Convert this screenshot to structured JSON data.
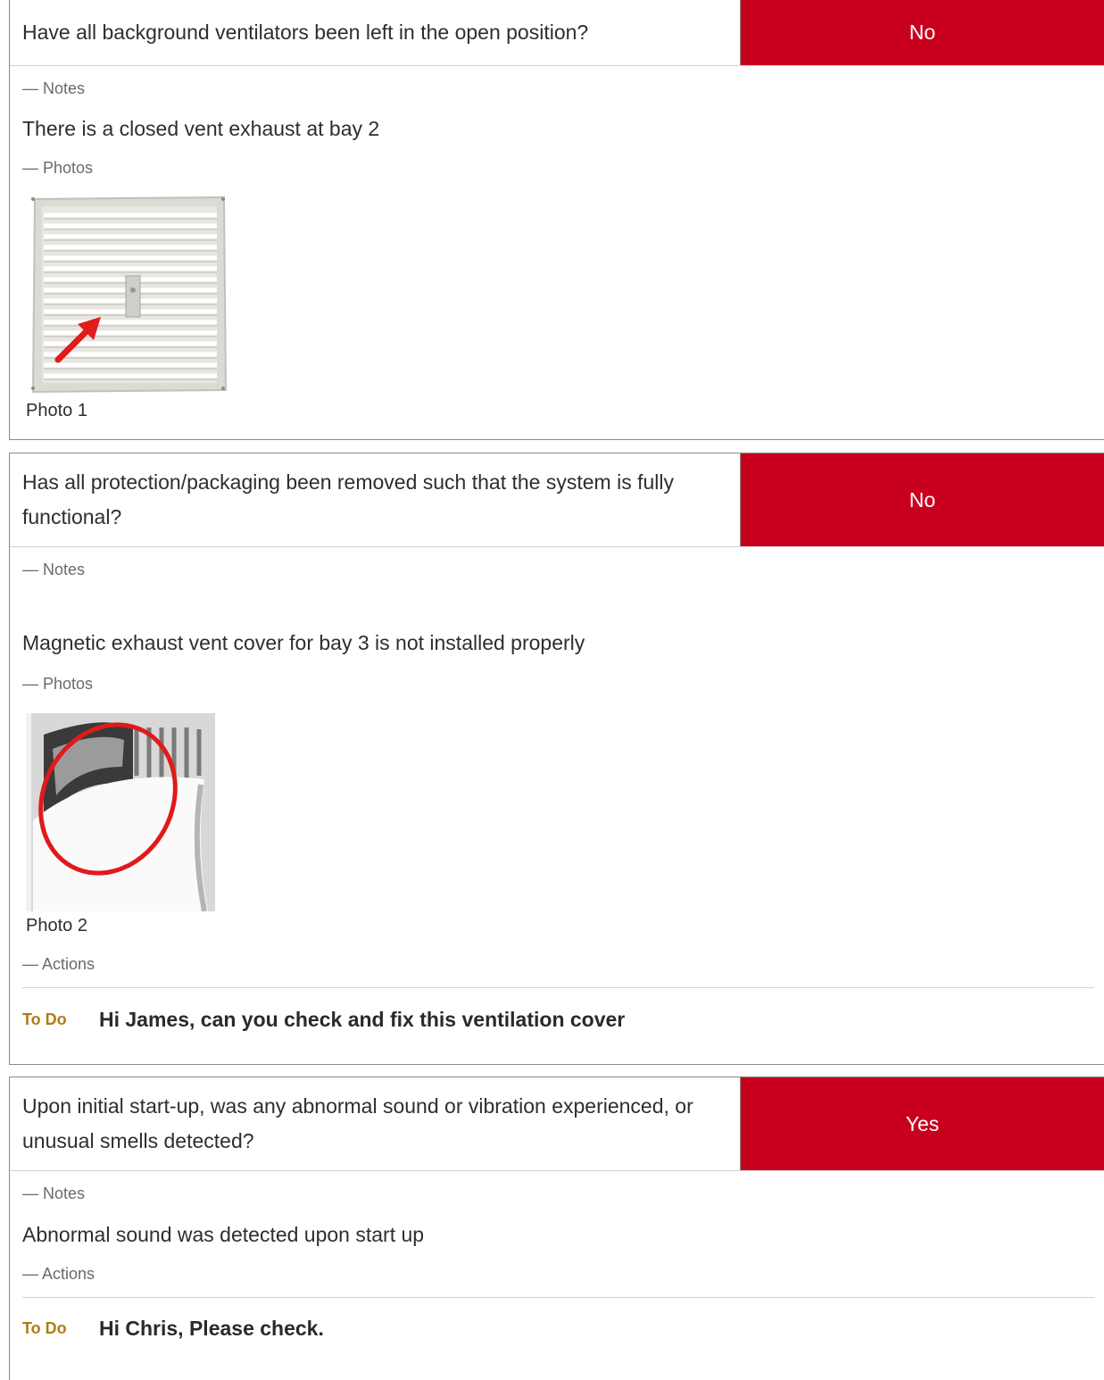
{
  "items": [
    {
      "question": "Have all background ventilators been left in the open position?",
      "answer": "No",
      "notes_label": "— Notes",
      "note": "There is a closed vent exhaust at bay 2",
      "photos_label": "— Photos",
      "photo_caption": "Photo 1"
    },
    {
      "question": "Has all protection/packaging been removed such that the system is fully functional?",
      "answer": "No",
      "notes_label": "— Notes",
      "note": "Magnetic exhaust vent cover for bay 3 is not installed properly",
      "photos_label": "— Photos",
      "photo_caption": "Photo 2",
      "actions_label": "— Actions",
      "action_status": "To Do",
      "action_text": "Hi James, can you check and fix this ventilation cover"
    },
    {
      "question": "Upon initial start-up, was any abnormal sound or vibration experienced, or unusual smells detected?",
      "answer": "Yes",
      "notes_label": "— Notes",
      "note": "Abnormal sound was detected upon start up",
      "actions_label": "— Actions",
      "action_status": "To Do",
      "action_text": "Hi Chris, Please check."
    }
  ],
  "colors": {
    "answer_bg": "#c8001e",
    "todo": "#b07d12"
  }
}
